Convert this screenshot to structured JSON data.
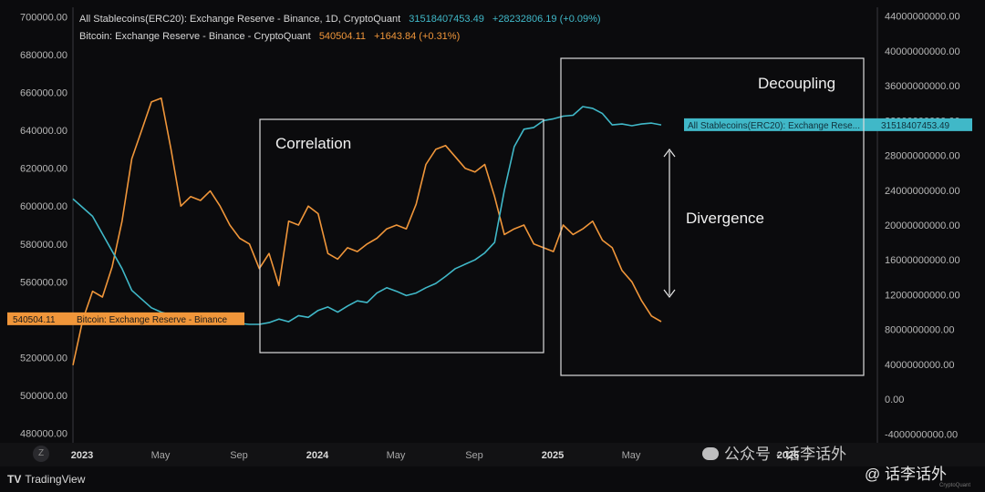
{
  "legend": {
    "stable": {
      "name": "All Stablecoins(ERC20): Exchange Reserve - Binance, 1D, CryptoQuant",
      "value": "31518407453.49",
      "change": "+28232806.19 (+0.09%)",
      "color": "#40b8c8"
    },
    "btc": {
      "name": "Bitcoin: Exchange Reserve - Binance - CryptoQuant",
      "value": "540504.11",
      "change": "+1643.84 (+0.31%)",
      "color": "#f0963a"
    }
  },
  "branding": {
    "tradingview": "TradingView",
    "z_button": "Z",
    "crypto_quant": "CryptoQuant",
    "watermark1": "公众号 · 话李话外",
    "watermark2": "@ 话李话外"
  },
  "chart_data": {
    "type": "line",
    "title": "All Stablecoins(ERC20): Exchange Reserve - Binance, 1D, CryptoQuant",
    "x_ticks": [
      "2023",
      "May",
      "Sep",
      "2024",
      "May",
      "Sep",
      "2025",
      "May",
      "2026"
    ],
    "x_tick_pos": [
      0,
      4,
      8,
      12,
      16,
      20,
      24,
      28,
      36
    ],
    "x_range": [
      0,
      30.2
    ],
    "left_axis": {
      "series": "Bitcoin: Exchange Reserve - Binance - CryptoQuant",
      "range": [
        475000,
        705000
      ],
      "ticks": [
        "700000.00",
        "680000.00",
        "660000.00",
        "640000.00",
        "620000.00",
        "600000.00",
        "580000.00",
        "560000.00",
        "540000.00",
        "520000.00",
        "500000.00",
        "480000.00"
      ]
    },
    "right_axis": {
      "series": "All Stablecoins(ERC20): Exchange Reserve - Binance",
      "range": [
        -5000000000,
        45000000000
      ],
      "ticks": [
        "44000000000.00",
        "40000000000.00",
        "36000000000.00",
        "32000000000.00",
        "28000000000.00",
        "24000000000.00",
        "20000000000.00",
        "16000000000.00",
        "12000000000.00",
        "8000000000.00",
        "4000000000.00",
        "0.00",
        "-4000000000.00"
      ]
    },
    "series": [
      {
        "name": "Bitcoin: Exchange Reserve - Binance",
        "axis": "left",
        "color": "#f0963a",
        "x": [
          0,
          0.5,
          1,
          1.5,
          2,
          2.5,
          3,
          3.5,
          4,
          4.5,
          5,
          5.5,
          6,
          6.5,
          7,
          7.5,
          8,
          8.5,
          9,
          9.5,
          10,
          10.5,
          11,
          11.5,
          12,
          12.5,
          13,
          13.5,
          14,
          14.5,
          15,
          15.5,
          16,
          16.5,
          17,
          17.5,
          18,
          18.5,
          19,
          19.5,
          20,
          20.5,
          21,
          21.5,
          22,
          22.5,
          23,
          23.5,
          24,
          24.5,
          25,
          25.5,
          26,
          26.5,
          27,
          27.5,
          28,
          28.5,
          29,
          29.5,
          30
        ],
        "y": [
          516000,
          540000,
          555000,
          552000,
          568000,
          592000,
          625000,
          640000,
          655000,
          657000,
          630000,
          600000,
          605000,
          603000,
          608000,
          600000,
          590000,
          583000,
          580000,
          567000,
          575000,
          558000,
          592000,
          590000,
          600000,
          596000,
          575000,
          572000,
          578000,
          576000,
          580000,
          583000,
          588000,
          590000,
          588000,
          601000,
          622000,
          630000,
          632000,
          626000,
          620000,
          618000,
          622000,
          605000,
          585000,
          588000,
          590000,
          580000,
          578000,
          576000,
          590000,
          585000,
          588000,
          592000,
          582000,
          578000,
          566000,
          560000,
          550000,
          542000,
          539000
        ]
      },
      {
        "name": "All Stablecoins(ERC20): Exchange Reserve - Binance",
        "axis": "right",
        "color": "#40b8c8",
        "x": [
          0,
          0.5,
          1,
          1.5,
          2,
          2.5,
          3,
          3.5,
          4,
          4.5,
          5,
          5.5,
          6,
          6.5,
          7,
          7.5,
          8,
          8.5,
          9,
          9.5,
          10,
          10.5,
          11,
          11.5,
          12,
          12.5,
          13,
          13.5,
          14,
          14.5,
          15,
          15.5,
          16,
          16.5,
          17,
          17.5,
          18,
          18.5,
          19,
          19.5,
          20,
          20.5,
          21,
          21.5,
          22,
          22.5,
          23,
          23.5,
          24,
          24.5,
          25,
          25.5,
          26,
          26.5,
          27,
          27.5,
          28,
          28.5,
          29,
          29.5,
          30
        ],
        "y": [
          23000000000,
          22000000000,
          21000000000,
          19000000000,
          17000000000,
          15000000000,
          12500000000,
          11500000000,
          10500000000,
          10000000000,
          9700000000,
          9300000000,
          9100000000,
          9600000000,
          9500000000,
          9200000000,
          9000000000,
          8700000000,
          8600000000,
          8600000000,
          8800000000,
          9200000000,
          8900000000,
          9600000000,
          9400000000,
          10200000000,
          10600000000,
          10000000000,
          10700000000,
          11300000000,
          11100000000,
          12200000000,
          12800000000,
          12400000000,
          11900000000,
          12200000000,
          12800000000,
          13300000000,
          14100000000,
          15000000000,
          15500000000,
          16000000000,
          16800000000,
          18000000000,
          24000000000,
          29000000000,
          31000000000,
          31200000000,
          32000000000,
          32200000000,
          32500000000,
          32600000000,
          33600000000,
          33400000000,
          32800000000,
          31500000000,
          31600000000,
          31400000000,
          31600000000,
          31700000000,
          31500000000
        ]
      }
    ],
    "last_value_labels": {
      "btc": {
        "value": "540504.11",
        "label": "Bitcoin: Exchange Reserve - Binance"
      },
      "stable": {
        "value": "31518407453.49",
        "label": "All Stablecoins(ERC20): Exchange Rese..."
      }
    },
    "annotations": {
      "box1": "Correlation",
      "box2": "Decoupling",
      "arrow": "Divergence"
    }
  }
}
